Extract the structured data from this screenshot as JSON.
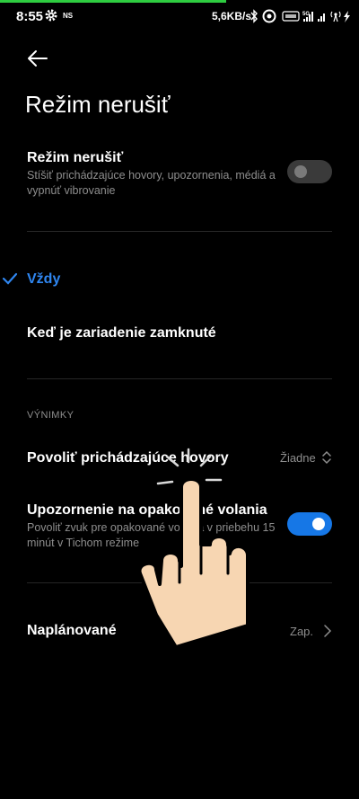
{
  "status_bar": {
    "time": "8:55",
    "ns_label": "NS",
    "speed": "5,6KB/s",
    "icons": [
      "gear-icon",
      "bluetooth-icon",
      "target-icon",
      "volte-icon",
      "signal-5g-icon",
      "signal-icon",
      "hotspot-icon",
      "charging-icon"
    ]
  },
  "header": {
    "back_icon": "back-arrow-icon",
    "title": "Režim nerušiť"
  },
  "dnd": {
    "title": "Režim nerušiť",
    "subtitle": "Stíšiť prichádzajúce hovory, upozornenia, médiá a vypnúť vibrovanie",
    "enabled": false
  },
  "options": {
    "always": "Vždy",
    "always_selected": true,
    "when_locked": "Keď je zariadenie zamknuté"
  },
  "exceptions": {
    "heading": "VÝNIMKY",
    "allow_calls_label": "Povoliť prichádzajúce hovory",
    "allow_calls_value": "Žiadne",
    "repeat_title": "Upozornenie na opakované volania",
    "repeat_subtitle": "Povoliť zvuk pre opakované volania v priebehu 15 minút v Tichom režime",
    "repeat_enabled": true
  },
  "scheduled": {
    "label": "Naplánované",
    "value": "Zap."
  },
  "colors": {
    "accent": "#2f86f0",
    "toggle_on": "#1677e6",
    "background": "#000000",
    "secondary_text": "#8e8e8e"
  }
}
